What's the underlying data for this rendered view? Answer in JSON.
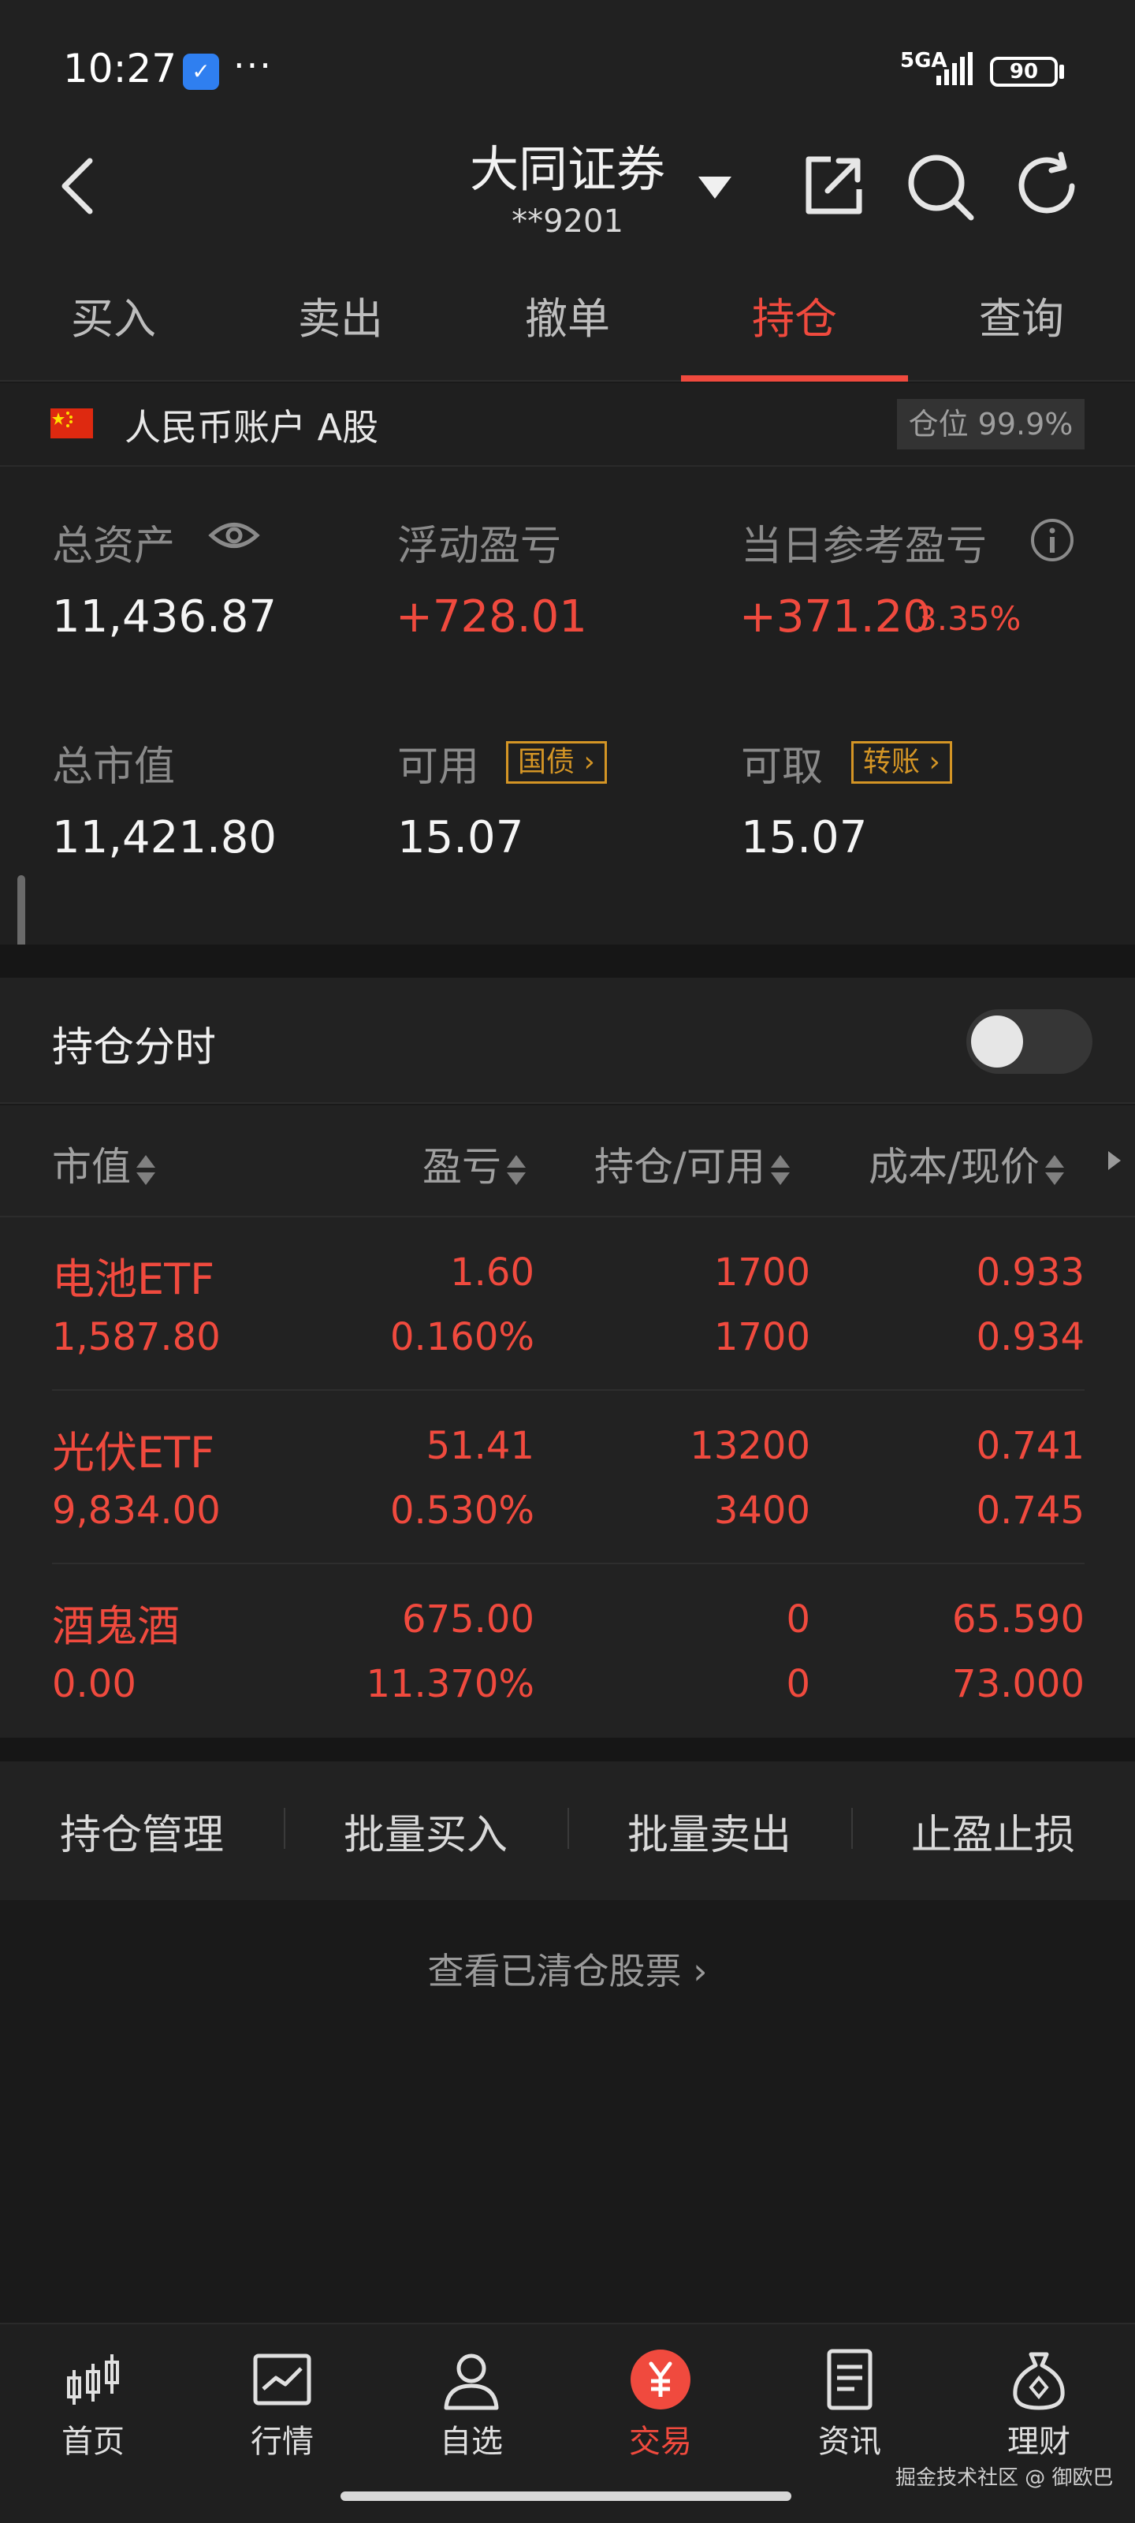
{
  "status_bar": {
    "time": "10:27",
    "network": "5GA",
    "battery": "90",
    "more": "···"
  },
  "header": {
    "title": "大同证券",
    "account_no": "**9201"
  },
  "tabs": [
    {
      "label": "买入"
    },
    {
      "label": "卖出"
    },
    {
      "label": "撤单"
    },
    {
      "label": "持仓",
      "active": true
    },
    {
      "label": "查询"
    }
  ],
  "account": {
    "label": "人民币账户 A股",
    "position": "仓位 99.9%"
  },
  "summary": {
    "total_assets_label": "总资产",
    "total_assets": "11,436.87",
    "floating_pl_label": "浮动盈亏",
    "floating_pl": "+728.01",
    "daily_pl_label": "当日参考盈亏",
    "daily_pl": "+371.20",
    "daily_pl_pct": "3.35%",
    "market_value_label": "总市值",
    "market_value": "11,421.80",
    "available_label": "可用",
    "available": "15.07",
    "available_tag": "国债",
    "withdrawable_label": "可取",
    "withdrawable": "15.07",
    "withdrawable_tag": "转账"
  },
  "realtime": {
    "label": "持仓分时",
    "enabled": false
  },
  "holdings": {
    "columns": [
      "市值",
      "盈亏",
      "持仓/可用",
      "成本/现价"
    ],
    "rows": [
      {
        "name": "电池ETF",
        "market_value": "1,587.80",
        "pl": "1.60",
        "pl_pct": "0.160%",
        "holding": "1700",
        "available": "1700",
        "cost": "0.933",
        "price": "0.934"
      },
      {
        "name": "光伏ETF",
        "market_value": "9,834.00",
        "pl": "51.41",
        "pl_pct": "0.530%",
        "holding": "13200",
        "available": "3400",
        "cost": "0.741",
        "price": "0.745"
      },
      {
        "name": "酒鬼酒",
        "market_value": "0.00",
        "pl": "675.00",
        "pl_pct": "11.370%",
        "holding": "0",
        "available": "0",
        "cost": "65.590",
        "price": "73.000"
      }
    ]
  },
  "actions": [
    "持仓管理",
    "批量买入",
    "批量卖出",
    "止盈止损"
  ],
  "cleared_link": "查看已清仓股票",
  "bottom_nav": [
    {
      "label": "首页",
      "icon": "candlestick-icon"
    },
    {
      "label": "行情",
      "icon": "chart-icon"
    },
    {
      "label": "自选",
      "icon": "person-icon"
    },
    {
      "label": "交易",
      "icon": "yuan-icon",
      "active": true
    },
    {
      "label": "资讯",
      "icon": "document-icon"
    },
    {
      "label": "理财",
      "icon": "money-bag-icon"
    }
  ],
  "watermark": "掘金技术社区 @ 御欧巴",
  "colors": {
    "accent": "#f04a3e",
    "gold": "#d49525",
    "background": "#1a1a1a"
  }
}
